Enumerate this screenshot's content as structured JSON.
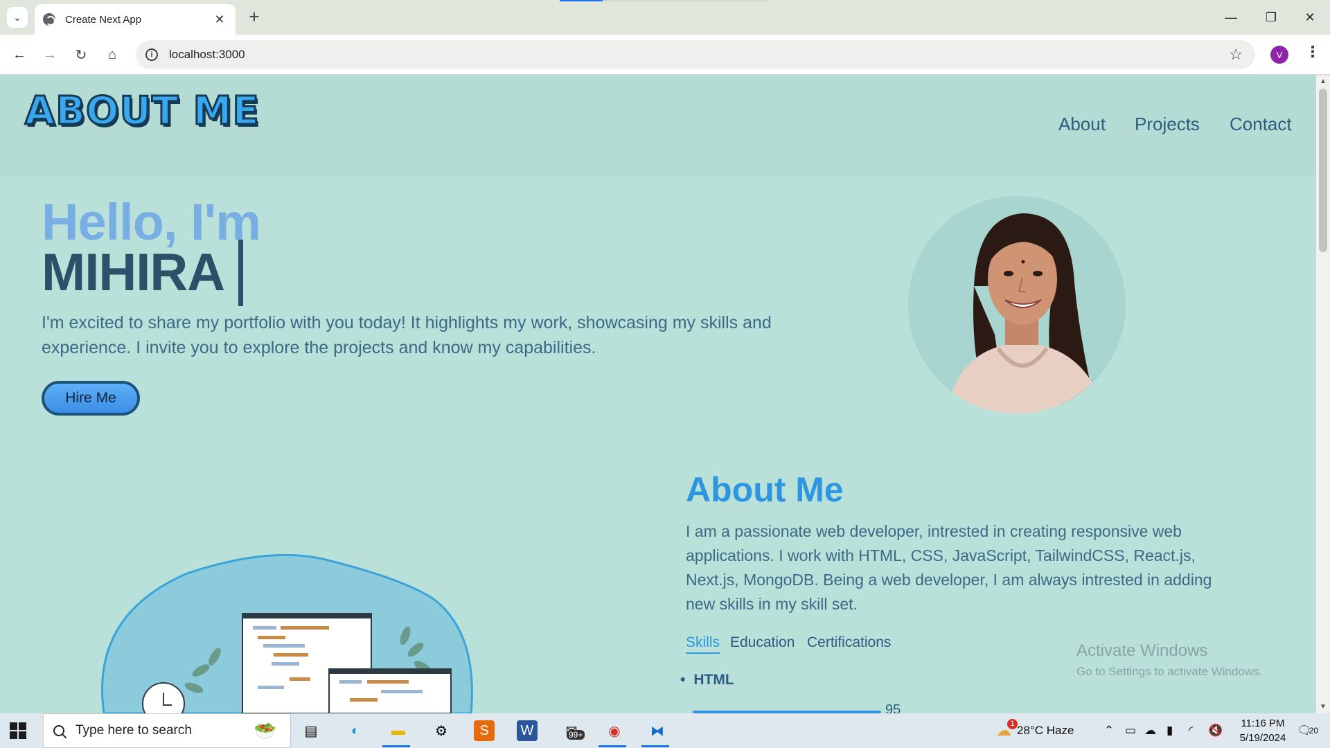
{
  "browser": {
    "tab_title": "Create Next App",
    "url": "localhost:3000",
    "profile_initial": "V"
  },
  "site": {
    "logo": "ABOUT ME",
    "nav": [
      "About",
      "Projects",
      "Contact"
    ],
    "hero": {
      "greeting": "Hello, I'm",
      "name": "MIHIRA",
      "intro": "I'm excited to share my portfolio with you today! It highlights my work, showcasing my skills and experience. I invite you to explore the projects and know my capabilities.",
      "cta": "Hire Me"
    },
    "about": {
      "title": "About Me",
      "text": "I am a passionate web developer, intrested in creating responsive web applications. I work with HTML, CSS, JavaScript, TailwindCSS, React.js, Next.js, MongoDB. Being a web developer, I am always intrested in adding new skills in my skill set.",
      "tabs": [
        "Skills",
        "Education",
        "Certifications"
      ],
      "active_tab": "Skills",
      "skills": [
        {
          "name": "HTML",
          "value": "95"
        }
      ]
    }
  },
  "watermark": {
    "line1": "Activate Windows",
    "line2": "Go to Settings to activate Windows."
  },
  "taskbar": {
    "search_placeholder": "Type here to search",
    "weather": "28°C  Haze",
    "mail_badge": "99+",
    "weather_badge": "1",
    "time": "11:16 PM",
    "date": "5/19/2024",
    "notifications": "20"
  },
  "colors": {
    "page_bg": "#b9e0d9",
    "header_bg": "#b4dcd5",
    "accent": "#2d96df",
    "name_color": "#2e4f68",
    "text_color": "#3b6a87"
  }
}
